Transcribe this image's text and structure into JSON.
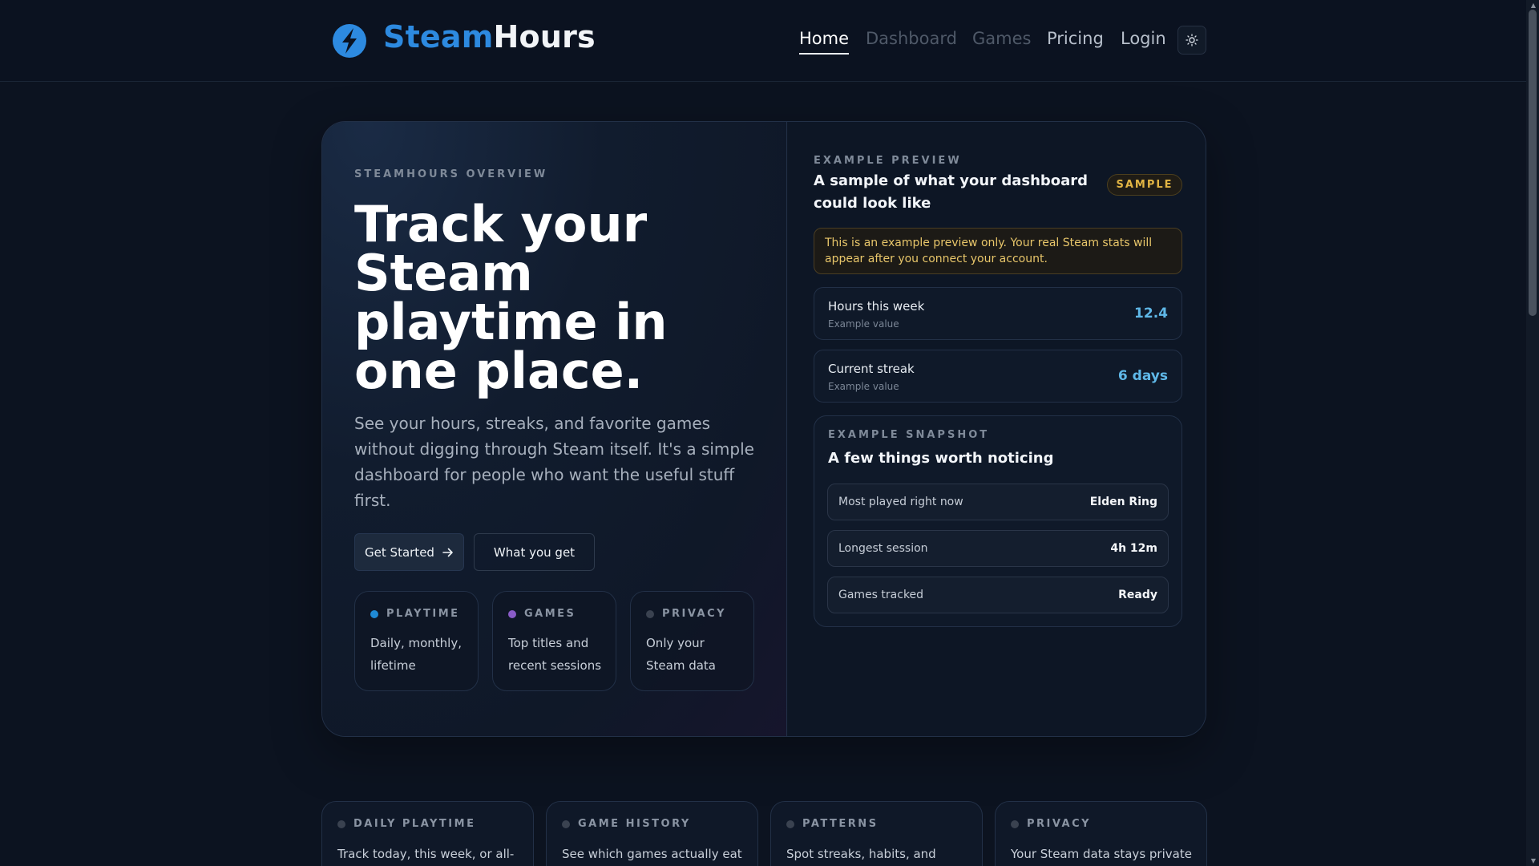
{
  "header": {
    "brand_part1": "Steam",
    "brand_part2": "Hours",
    "nav": [
      "Home",
      "Dashboard",
      "Games",
      "Pricing",
      "Login"
    ],
    "theme_toggle_icon": "sun-icon"
  },
  "hero": {
    "eyebrow": "STEAMHOURS OVERVIEW",
    "title": "Track your Steam playtime in one place.",
    "description": "See your hours, streaks, and favorite games without digging through Steam itself. It's a simple dashboard for people who want the useful stuff first.",
    "cta_primary": "Get Started",
    "cta_secondary": "What you get",
    "mini_cards": [
      {
        "tag": "PLAYTIME",
        "text": "Daily, monthly, lifetime",
        "dot_color": "#1f8ad6"
      },
      {
        "tag": "GAMES",
        "text": "Top titles and recent sessions",
        "dot_color": "#8a5cc8"
      },
      {
        "tag": "PRIVACY",
        "text": "Only your Steam data",
        "dot_color": "#3a4250"
      }
    ]
  },
  "preview": {
    "eyebrow": "EXAMPLE PREVIEW",
    "title": "A sample of what your dashboard could look like",
    "badge": "SAMPLE",
    "notice": "This is an example preview only. Your real Steam stats will appear after you connect your account.",
    "stats": [
      {
        "label": "Hours this week",
        "sub": "Example value",
        "value": "12.4"
      },
      {
        "label": "Current streak",
        "sub": "Example value",
        "value": "6 days"
      }
    ],
    "snapshot": {
      "eyebrow": "EXAMPLE SNAPSHOT",
      "title": "A few things worth noticing",
      "rows": [
        {
          "key": "Most played right now",
          "value": "Elden Ring"
        },
        {
          "key": "Longest session",
          "value": "4h 12m"
        },
        {
          "key": "Games tracked",
          "value": "Ready"
        }
      ]
    }
  },
  "features": [
    {
      "tag": "DAILY PLAYTIME",
      "text": "Track today, this week, or all-"
    },
    {
      "tag": "GAME HISTORY",
      "text": "See which games actually eat"
    },
    {
      "tag": "PATTERNS",
      "text": "Spot streaks, habits, and"
    },
    {
      "tag": "PRIVACY",
      "text": "Your Steam data stays private"
    }
  ],
  "colors": {
    "accent": "#2d8ae0",
    "stat_value": "#5fb8e8",
    "sample_badge": "#e2b544",
    "background": "#0c1320"
  }
}
